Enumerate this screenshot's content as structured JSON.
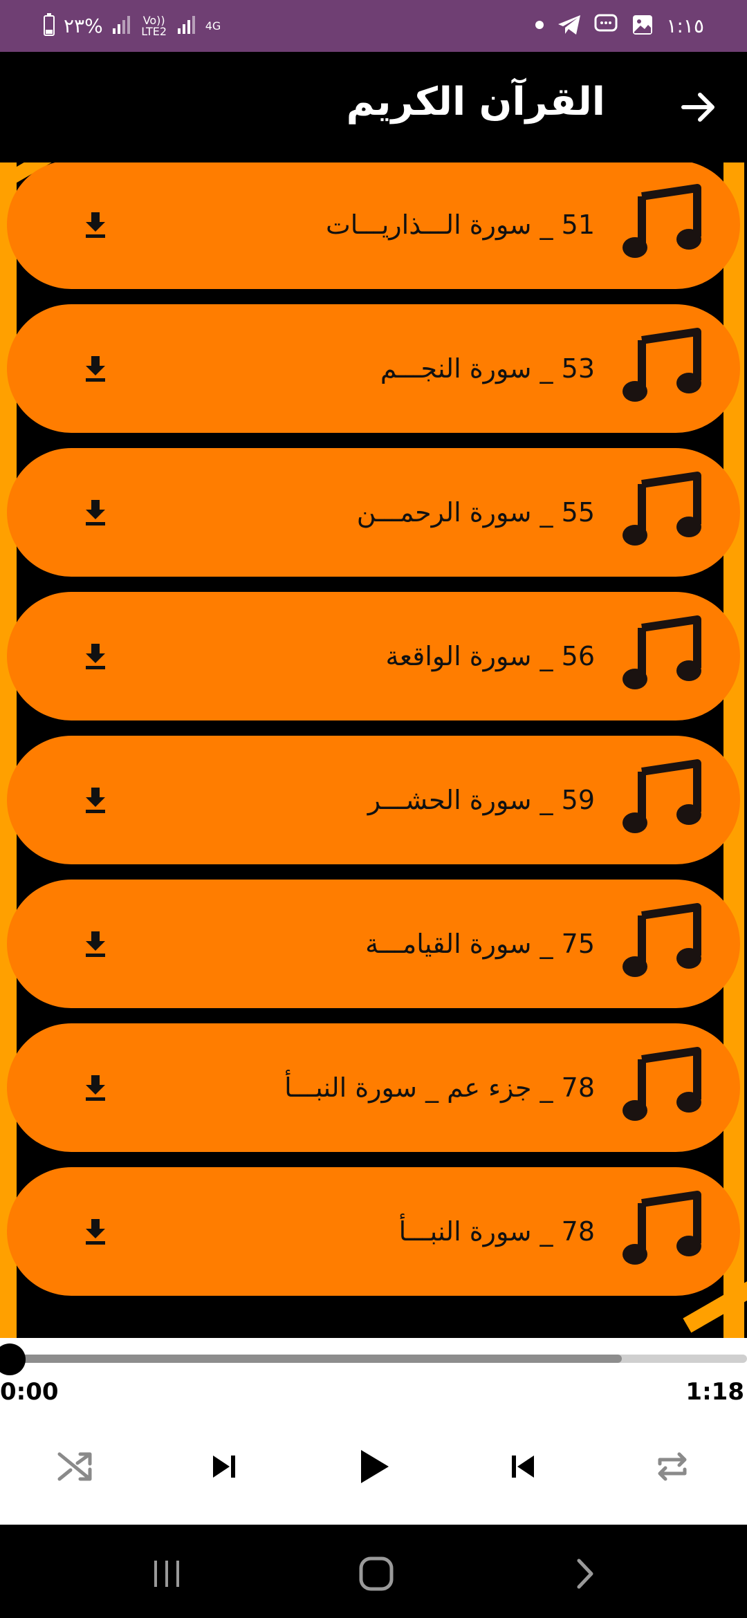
{
  "status_bar": {
    "time": "١:١٥",
    "battery": "٢٣%",
    "network_1": "Vo)) LTE2",
    "network_2": "4G",
    "icons": [
      "dot-icon",
      "telegram-icon",
      "messenger-icon",
      "gallery-icon"
    ]
  },
  "header": {
    "title": "القرآن الكريم",
    "back_icon": "arrow-right-icon"
  },
  "colors": {
    "status_bar": "#6f3f73",
    "item_bg": "#ff7d00",
    "stripe": "#ffa000",
    "background": "#000000"
  },
  "list": {
    "items": [
      {
        "label": "51  _  سورة الـــذاريـــات"
      },
      {
        "label": "53  _  سورة النجـــم"
      },
      {
        "label": "55  _  سورة الرحمـــن"
      },
      {
        "label": "56  _  سورة الواقعة"
      },
      {
        "label": "59  _  سورة الحشـــر"
      },
      {
        "label": "75  _  سورة القيامـــة"
      },
      {
        "label": "78  _  جزء عم _ سورة النبـــأ"
      },
      {
        "label": "78  _  سورة النبـــأ"
      }
    ]
  },
  "player": {
    "current_time": "0:00",
    "duration": "1:18",
    "buffered_fraction": 0.83,
    "progress_fraction": 0.0,
    "controls": [
      "shuffle-icon",
      "skip-next-icon",
      "play-icon",
      "skip-previous-icon",
      "repeat-icon"
    ]
  },
  "nav_bar": {
    "buttons": [
      "recents-icon",
      "home-icon",
      "back-icon"
    ]
  }
}
